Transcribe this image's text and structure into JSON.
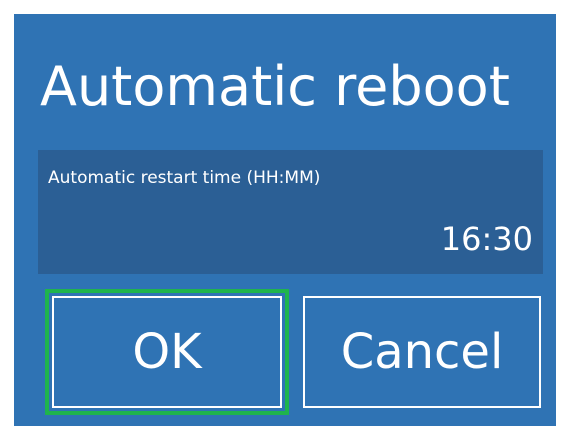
{
  "dialog": {
    "title": "Automatic reboot",
    "field": {
      "label": "Automatic restart time (HH:MM)",
      "value": "16:30"
    },
    "buttons": {
      "ok_label": "OK",
      "cancel_label": "Cancel"
    },
    "colors": {
      "background": "#2f73b4",
      "field_background": "#2b5f95",
      "focus_ring": "#1fb44d",
      "text": "#ffffff"
    },
    "focused_button": "OK"
  }
}
